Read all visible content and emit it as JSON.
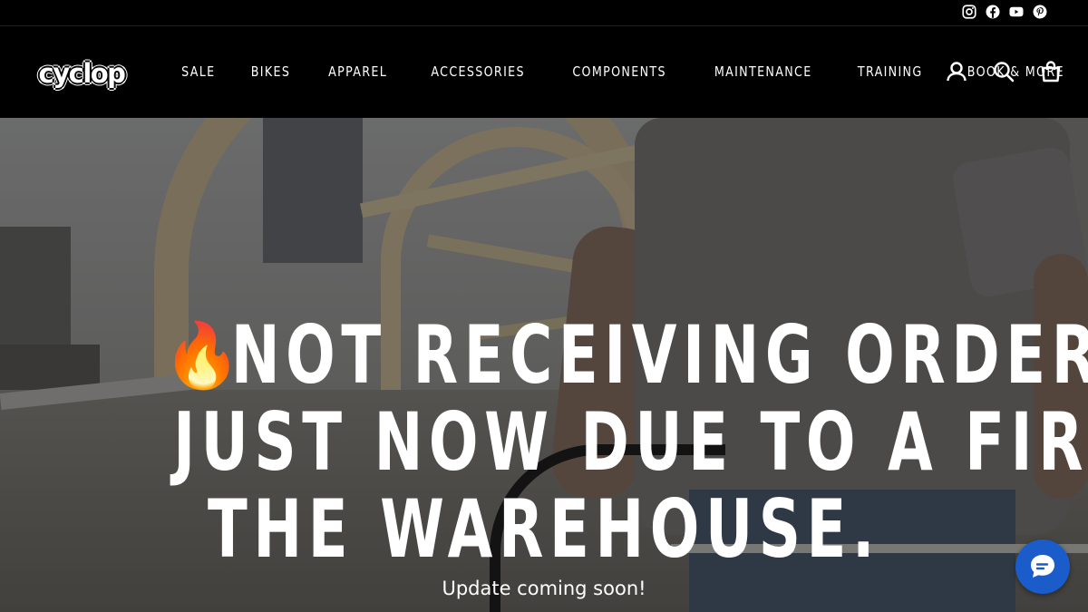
{
  "brand": {
    "logo_text": "cyclop"
  },
  "topbar": {
    "social_icons": [
      "instagram-icon",
      "facebook-icon",
      "youtube-icon",
      "pinterest-icon"
    ]
  },
  "nav": {
    "items": [
      {
        "label": "SALE"
      },
      {
        "label": "BIKES"
      },
      {
        "label": "APPAREL"
      },
      {
        "label": "ACCESSORIES"
      },
      {
        "label": "COMPONENTS"
      },
      {
        "label": "MAINTENANCE"
      },
      {
        "label": "TRAINING"
      },
      {
        "label": "BOOK & MORE"
      }
    ]
  },
  "header_icons": [
    "account-icon",
    "search-icon",
    "cart-icon"
  ],
  "hero": {
    "emoji": "🔥",
    "line1": "NOT RECEIVING ORDERS",
    "line2": "JUST NOW DUE TO A FIRE IN",
    "line3": "THE WAREHOUSE.",
    "subheading": "Update coming soon!"
  },
  "chat": {
    "icon": "chat-icon",
    "color": "#1a5cc9"
  },
  "colors": {
    "header_bg": "#000000",
    "text": "#ffffff"
  }
}
